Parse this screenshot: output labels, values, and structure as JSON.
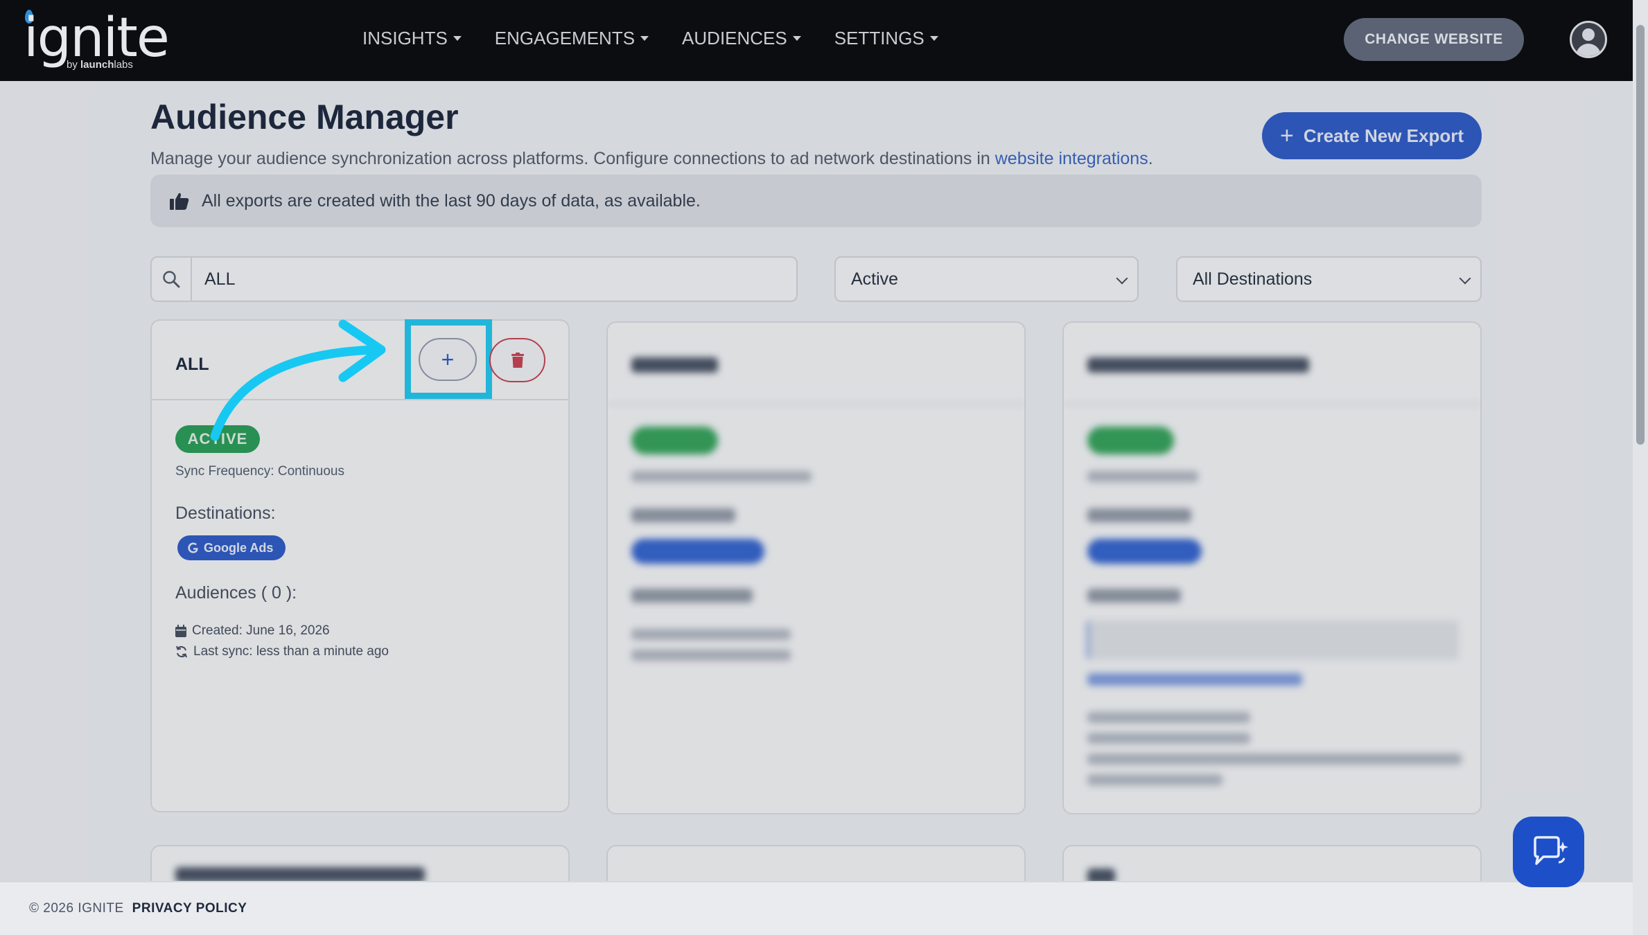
{
  "brand": {
    "logo_text": "ignite",
    "by": "by ",
    "by_bold": "launch",
    "by_rest": "labs"
  },
  "nav": [
    {
      "label": "INSIGHTS"
    },
    {
      "label": "ENGAGEMENTS"
    },
    {
      "label": "AUDIENCES"
    },
    {
      "label": "SETTINGS"
    }
  ],
  "header": {
    "change_website": "CHANGE WEBSITE"
  },
  "page": {
    "title": "Audience Manager",
    "description": "Manage your audience synchronization across platforms. Configure connections to ad network destinations in ",
    "description_link": "website integrations",
    "description_end": ".",
    "create_button": "Create New Export",
    "info": "All exports are created with the last 90 days of data, as available."
  },
  "filters": {
    "search_value": "ALL",
    "status_selected": "Active",
    "destination_selected": "All Destinations"
  },
  "card": {
    "title": "ALL",
    "add_label": "+",
    "status": "ACTIVE",
    "sync_frequency": "Sync Frequency: Continuous",
    "destinations_label": "Destinations:",
    "destination": "Google Ads",
    "audiences_label": "Audiences ( 0 ):",
    "created": "Created: June 16, 2026",
    "last_sync": "Last sync: less than a minute ago"
  },
  "footer": {
    "copyright": "© 2026 IGNITE",
    "privacy": "PRIVACY POLICY"
  },
  "colors": {
    "accent": "#2353c6",
    "active": "#1e9b4d",
    "delete": "#c7394a",
    "highlight": "#17c8f3",
    "topbar": "#0b0d10"
  }
}
